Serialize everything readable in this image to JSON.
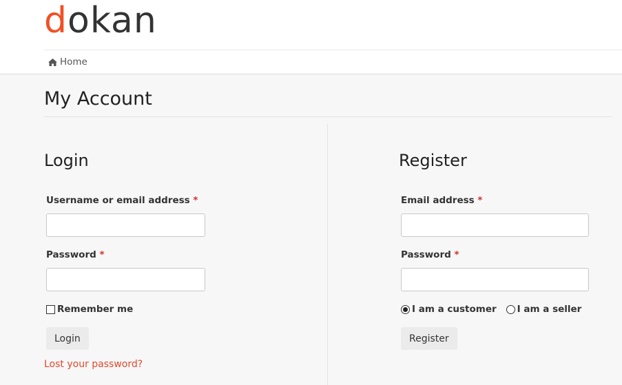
{
  "header": {
    "logo_first": "d",
    "logo_rest": "okan",
    "breadcrumb": {
      "icon": "home-icon",
      "label": "Home"
    }
  },
  "page": {
    "title": "My Account"
  },
  "login": {
    "title": "Login",
    "username_label": "Username or email address",
    "password_label": "Password",
    "required_mark": "*",
    "username_value": "",
    "password_value": "",
    "remember_label": "Remember me",
    "remember_checked": false,
    "submit_label": "Login",
    "lost_password_label": "Lost your password?"
  },
  "register": {
    "title": "Register",
    "email_label": "Email address",
    "password_label": "Password",
    "required_mark": "*",
    "email_value": "",
    "password_value": "",
    "role_options": [
      {
        "label": "I am a customer",
        "selected": true
      },
      {
        "label": "I am a seller",
        "selected": false
      }
    ],
    "submit_label": "Register"
  },
  "colors": {
    "brand": "#f05025",
    "link": "#e2492c",
    "required": "#d32f2f"
  }
}
